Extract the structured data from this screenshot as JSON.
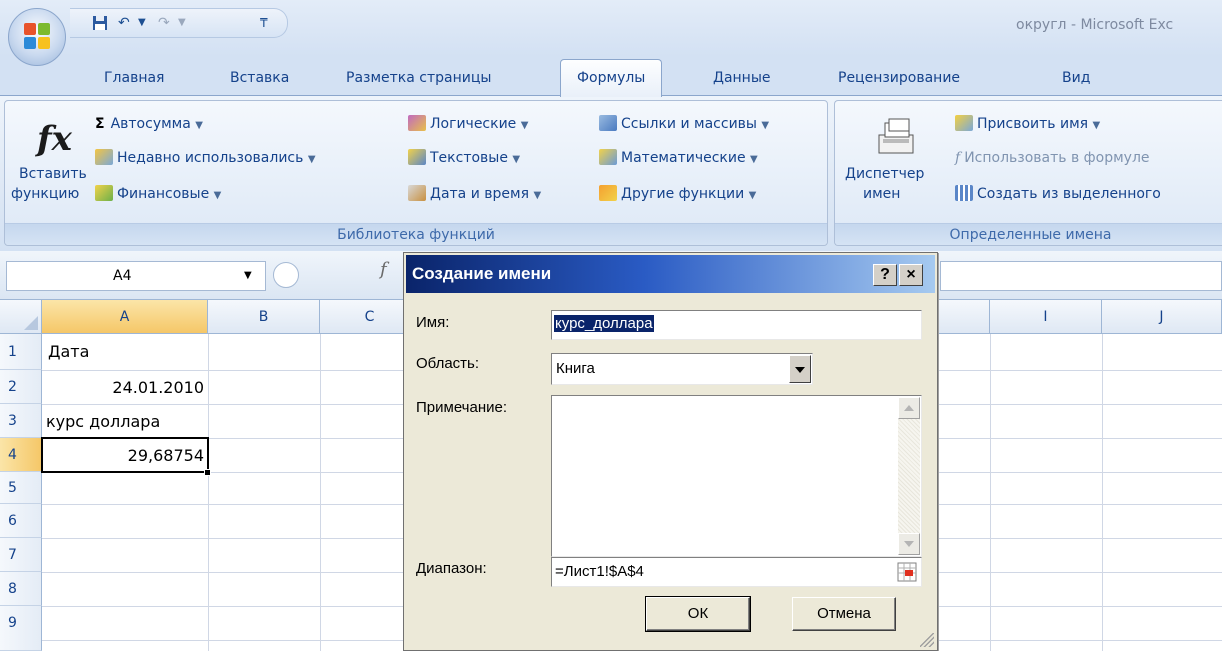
{
  "window": {
    "title": "округл - Microsoft Excel",
    "title_visible": "округл - Microsoft Exc"
  },
  "tabs": [
    {
      "label": "Главная"
    },
    {
      "label": "Вставка"
    },
    {
      "label": "Разметка страницы"
    },
    {
      "label": "Формулы",
      "active": true
    },
    {
      "label": "Данные"
    },
    {
      "label": "Рецензирование"
    },
    {
      "label": "Вид"
    }
  ],
  "ribbon": {
    "function_library": {
      "label": "Библиотека функций",
      "insert_function_line1": "Вставить",
      "insert_function_line2": "функцию",
      "fx_glyph": "fx",
      "autosum": "Автосумма",
      "autosum_glyph": "Σ",
      "recent": "Недавно использовались",
      "financial": "Финансовые",
      "logical": "Логические",
      "text": "Текстовые",
      "datetime": "Дата и время",
      "lookup": "Ссылки и массивы",
      "math": "Математические",
      "other": "Другие функции"
    },
    "defined_names": {
      "label": "Определенные имена",
      "manager_line1": "Диспетчер",
      "manager_line2": "имен",
      "define_name": "Присвоить имя",
      "use_in_formula": "Использовать в формуле",
      "create_from_selection": "Создать из выделенного"
    }
  },
  "formula_bar": {
    "name_box": "A4",
    "fx_glyph": "f"
  },
  "sheet": {
    "columns": [
      "A",
      "B",
      "C",
      "I",
      "J"
    ],
    "rows": [
      "1",
      "2",
      "3",
      "4",
      "5",
      "6",
      "7",
      "8",
      "9"
    ],
    "cells": {
      "A1": "Дата",
      "A2": "24.01.2010",
      "A3": "курс доллара",
      "A4": "29,68754"
    },
    "active_cell": "A4"
  },
  "dialog": {
    "title": "Создание имени",
    "help_btn": "?",
    "close_btn": "×",
    "name_label": "Имя:",
    "name_value": "курс_доллара",
    "scope_label": "Область:",
    "scope_value": "Книга",
    "comment_label": "Примечание:",
    "comment_value": "",
    "range_label": "Диапазон:",
    "range_value": "=Лист1!$A$4",
    "ok": "ОК",
    "cancel": "Отмена"
  },
  "colors": {
    "ribbon_text": "#15428b",
    "dialog_title_start": "#0a246a",
    "dialog_title_end": "#a6caf0",
    "selection_header": "#f5c768"
  }
}
